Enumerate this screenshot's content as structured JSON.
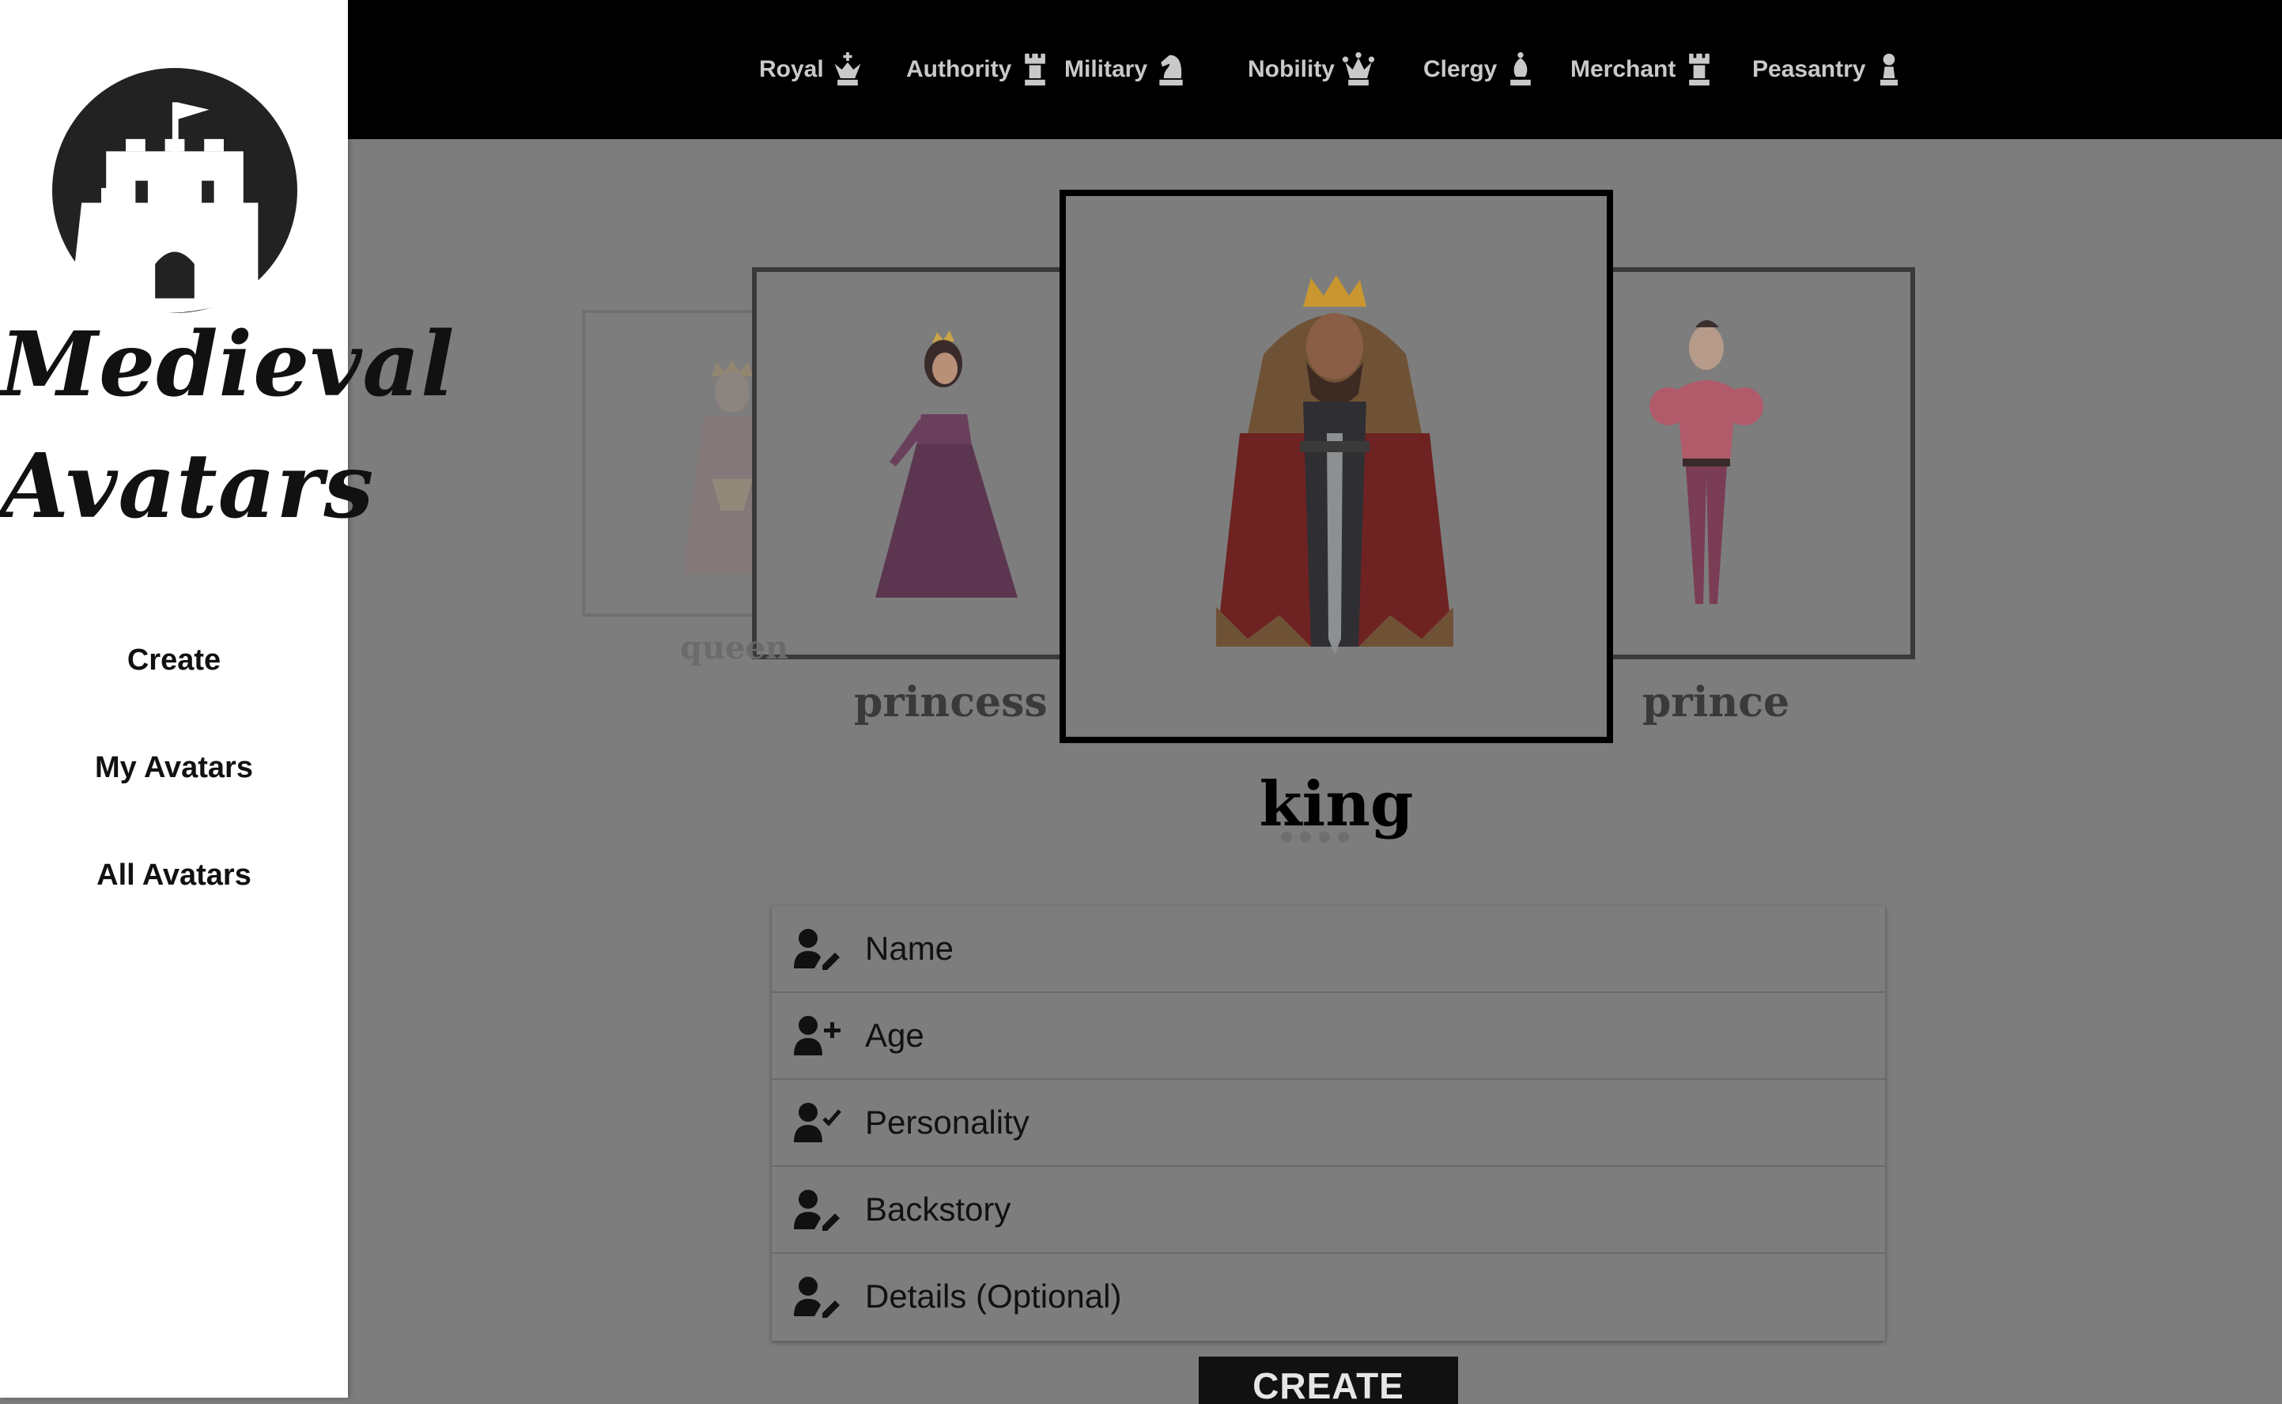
{
  "brand": {
    "line1": "Medieval",
    "line2": "Avatars",
    "logo": "castle-icon"
  },
  "sidebar": {
    "items": [
      {
        "label": "Create"
      },
      {
        "label": "My Avatars"
      },
      {
        "label": "All Avatars"
      }
    ]
  },
  "categories": [
    {
      "label": "Royal",
      "icon": "chess-king-icon"
    },
    {
      "label": "Authority",
      "icon": "chess-rook-icon"
    },
    {
      "label": "Military",
      "icon": "chess-knight-icon"
    },
    {
      "label": "Nobility",
      "icon": "chess-queen-icon"
    },
    {
      "label": "Clergy",
      "icon": "chess-bishop-icon"
    },
    {
      "label": "Merchant",
      "icon": "chess-rook-icon"
    },
    {
      "label": "Peasantry",
      "icon": "chess-pawn-icon"
    }
  ],
  "carousel": {
    "cards": [
      {
        "label": "queen"
      },
      {
        "label": "princess"
      },
      {
        "label": "king"
      },
      {
        "label": "prince"
      }
    ],
    "selected": "king"
  },
  "form": {
    "fields": [
      {
        "placeholder": "Name",
        "icon": "user-edit-icon"
      },
      {
        "placeholder": "Age",
        "icon": "user-plus-icon"
      },
      {
        "placeholder": "Personality",
        "icon": "user-check-icon"
      },
      {
        "placeholder": "Backstory",
        "icon": "user-edit-icon"
      },
      {
        "placeholder": "Details (Optional)",
        "icon": "user-edit-icon"
      }
    ]
  },
  "actions": {
    "create_label": "CREATE"
  },
  "colors": {
    "sidebar_bg": "#ffffff",
    "topbar_bg": "#000000",
    "overlay_bg": "#7d7d7d",
    "accent": "#111111"
  }
}
